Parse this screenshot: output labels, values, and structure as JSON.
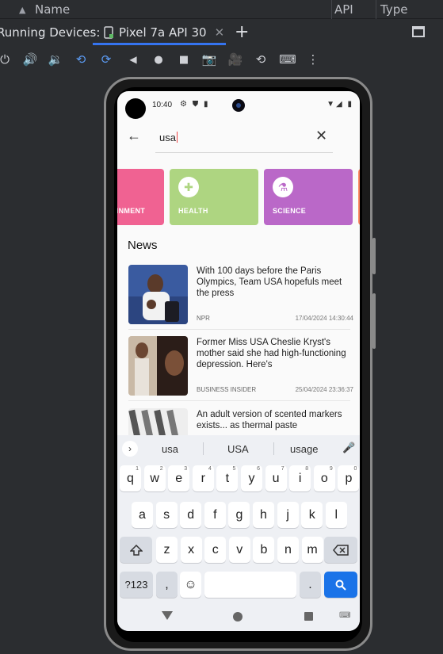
{
  "ide": {
    "columns": {
      "name": "Name",
      "api": "API",
      "type": "Type"
    },
    "running_devices_label": "Running Devices:",
    "device_tab": "Pixel 7a API 30",
    "toolbar_icons": [
      "power-icon",
      "volume-up-icon",
      "volume-down-icon",
      "rotate-left-icon",
      "rotate-right-icon",
      "back-icon",
      "home-icon",
      "overview-icon",
      "screenshot-icon",
      "screen-record-icon",
      "snapshot-icon",
      "keyboard-icon",
      "more-icon"
    ]
  },
  "phone": {
    "status": {
      "time": "10:40"
    },
    "search": {
      "query": "usa"
    },
    "categories": [
      {
        "label": "AINMENT",
        "color": "#f06292"
      },
      {
        "label": "HEALTH",
        "color": "#aed581"
      },
      {
        "label": "SCIENCE",
        "color": "#ba68c8"
      }
    ],
    "news_heading": "News",
    "articles": [
      {
        "headline": "With 100 days before the Paris Olympics, Team USA hopefuls meet the press",
        "source": "NPR",
        "time": "17/04/2024 14:30:44"
      },
      {
        "headline": "Former Miss USA Cheslie Kryst's mother said she had high-functioning depression. Here's",
        "source": "BUSINESS INSIDER",
        "time": "25/04/2024 23:36:37"
      },
      {
        "headline": "An adult version of scented markers exists... as thermal paste",
        "source": "",
        "time": ""
      }
    ],
    "keyboard": {
      "suggestions": [
        "usa",
        "USA",
        "usage"
      ],
      "row1": [
        "q",
        "w",
        "e",
        "r",
        "t",
        "y",
        "u",
        "i",
        "o",
        "p"
      ],
      "row1_hints": [
        "1",
        "2",
        "3",
        "4",
        "5",
        "6",
        "7",
        "8",
        "9",
        "0"
      ],
      "row2": [
        "a",
        "s",
        "d",
        "f",
        "g",
        "h",
        "j",
        "k",
        "l"
      ],
      "row3": [
        "z",
        "x",
        "c",
        "v",
        "b",
        "n",
        "m"
      ],
      "symbols": "?123",
      "comma": ",",
      "period": "."
    }
  }
}
